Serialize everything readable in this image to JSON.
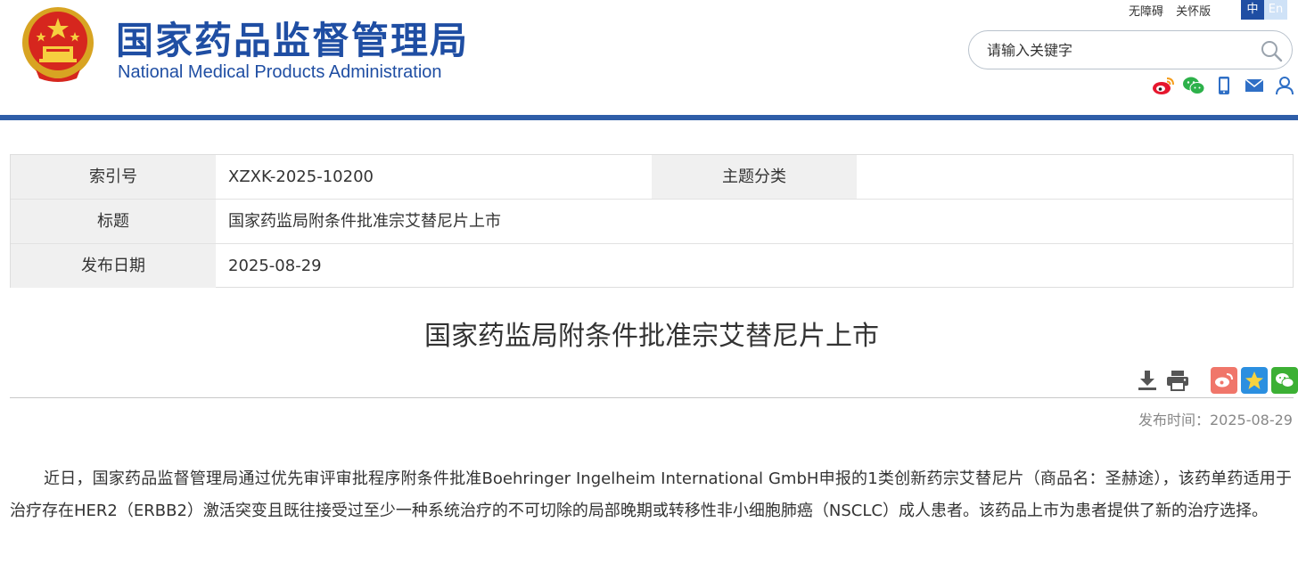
{
  "header": {
    "site_name_cn": "国家药品监督管理局",
    "site_name_en": "National Medical Products Administration",
    "links": {
      "accessibility": "无障碍",
      "care_mode": "关怀版"
    },
    "lang": {
      "zh": "中",
      "en": "En"
    },
    "search": {
      "placeholder": "请输入关键字"
    },
    "social_icons": [
      "weibo-icon",
      "wechat-icon",
      "mobile-icon",
      "mail-icon",
      "user-icon"
    ]
  },
  "colors": {
    "brand_blue": "#1f4ea3",
    "bar_blue": "#2f5ea8",
    "label_bg": "#f0f0f0"
  },
  "meta": {
    "index_label": "索引号",
    "index_value": "XZXK-2025-10200",
    "category_label": "主题分类",
    "category_value": "",
    "title_label": "标题",
    "title_value": "国家药监局附条件批准宗艾替尼片上市",
    "date_label": "发布日期",
    "date_value": "2025-08-29"
  },
  "article": {
    "title": "国家药监局附条件批准宗艾替尼片上市",
    "publish_time": "发布时间：2025-08-29",
    "body": "近日，国家药品监督管理局通过优先审评审批程序附条件批准Boehringer Ingelheim International GmbH申报的1类创新药宗艾替尼片（商品名：圣赫途），该药单药适用于治疗存在HER2（ERBB2）激活突变且既往接受过至少一种系统治疗的不可切除的局部晚期或转移性非小细胞肺癌（NSCLC）成人患者。该药品上市为患者提供了新的治疗选择。"
  }
}
